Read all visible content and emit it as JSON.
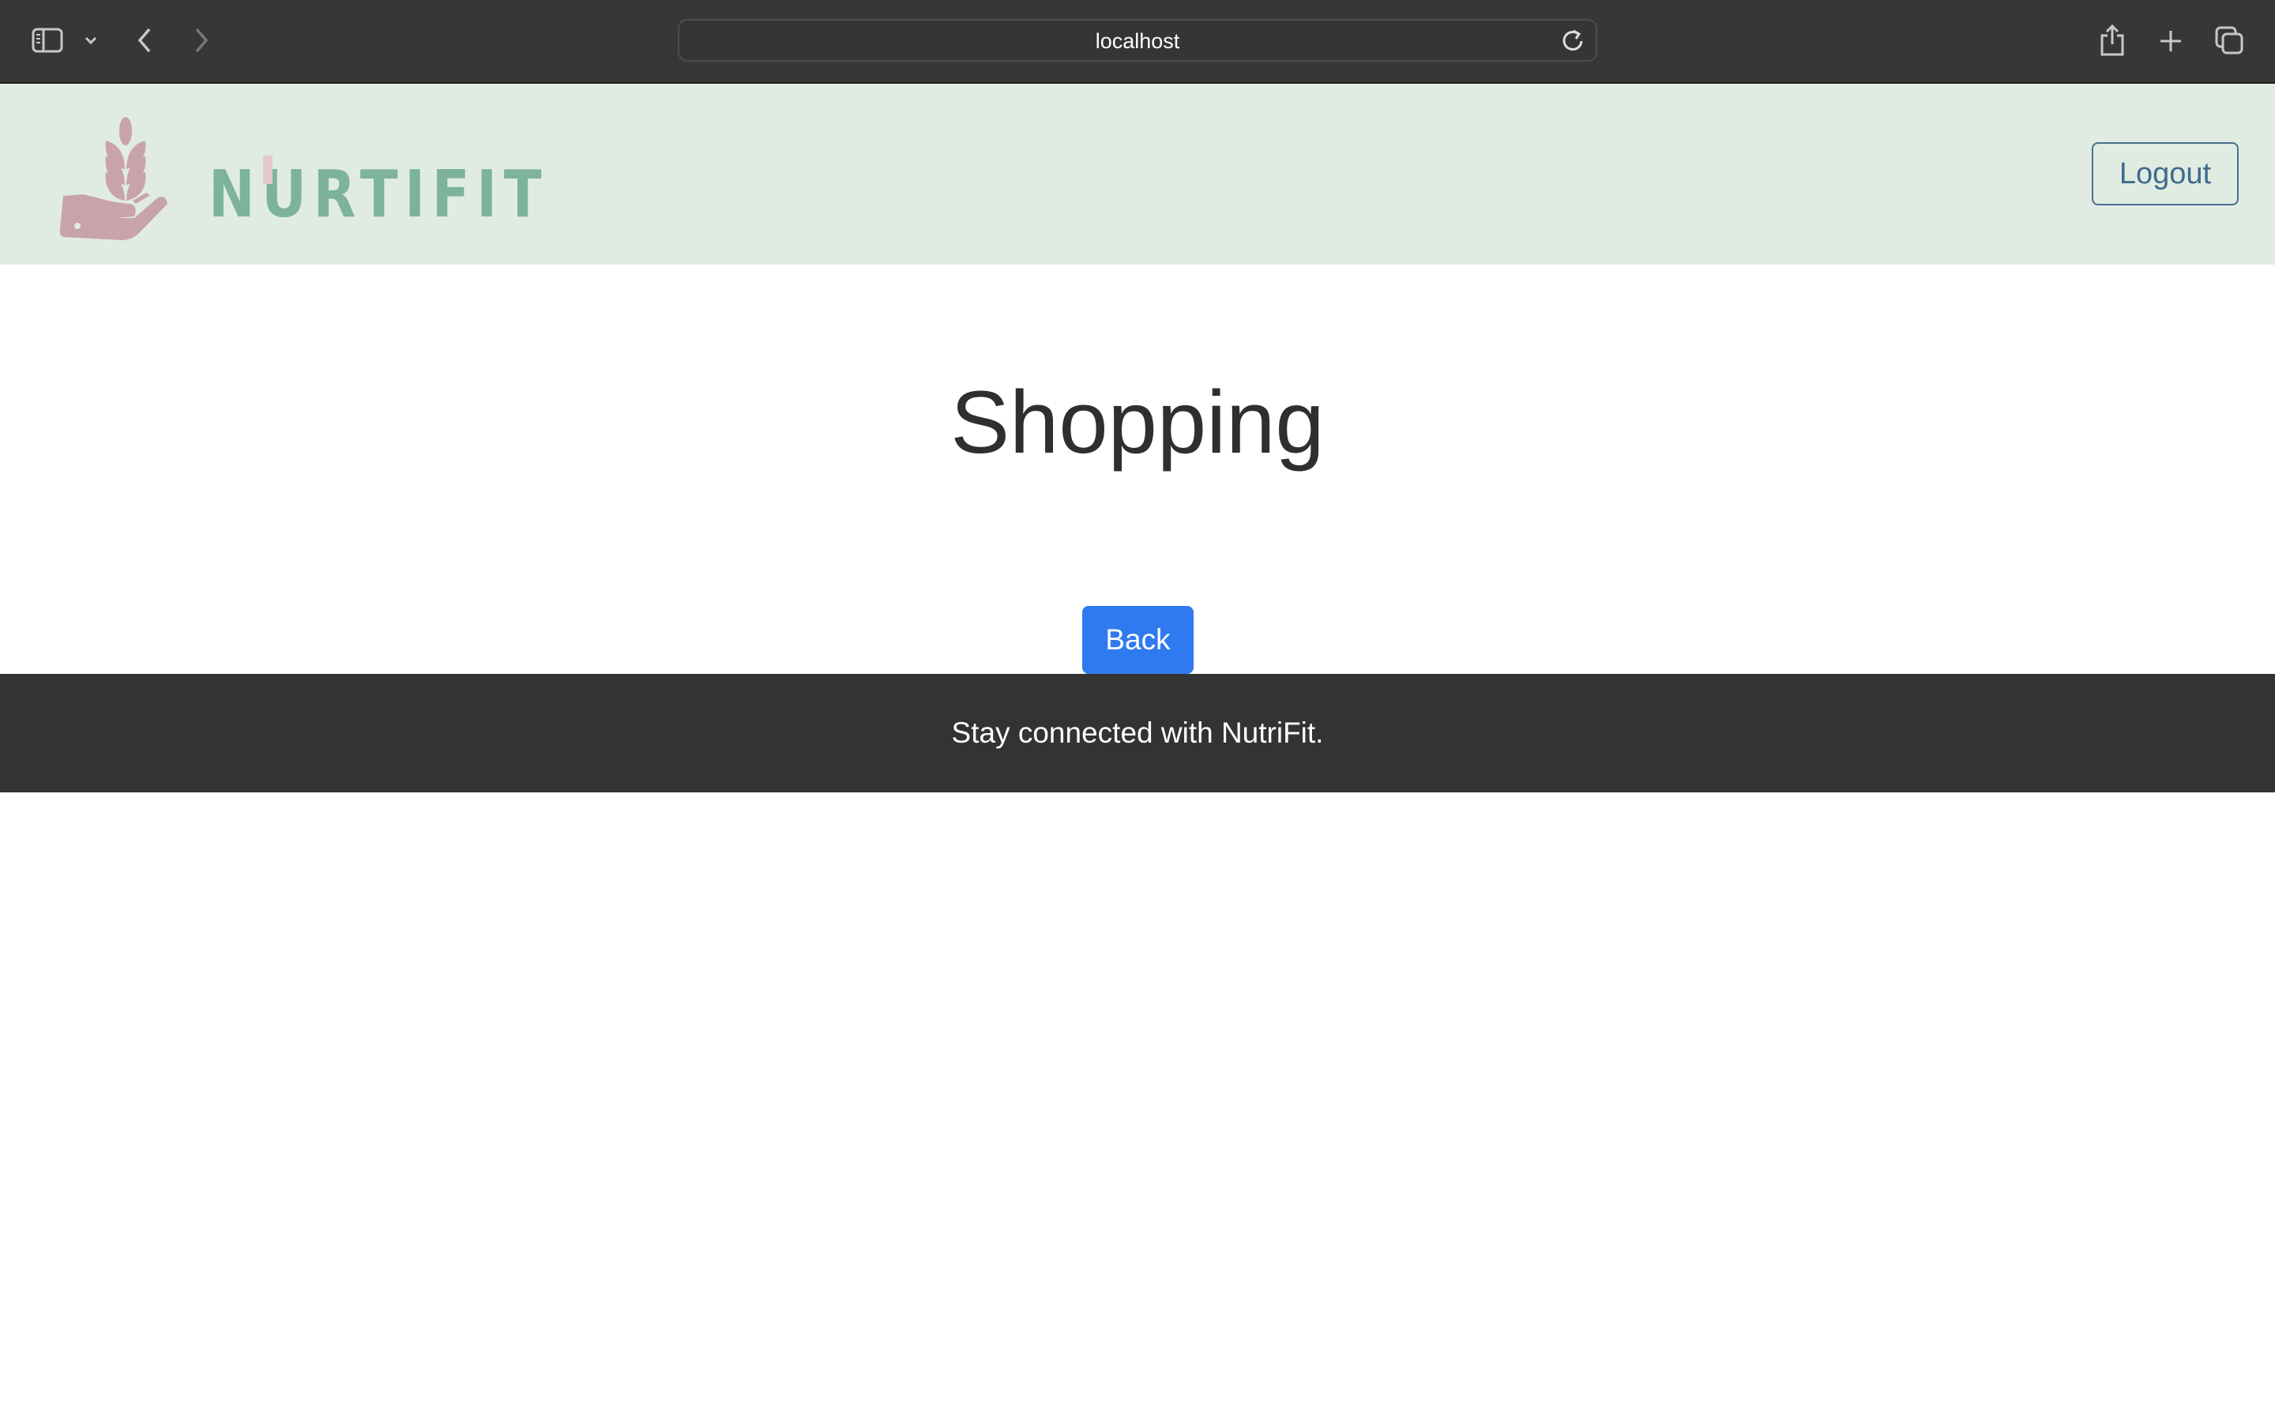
{
  "browser": {
    "url": "localhost",
    "icons": [
      "sidebar-icon",
      "chevron-down-icon",
      "back-icon",
      "forward-icon",
      "reload-icon",
      "share-icon",
      "new-tab-icon",
      "tabs-overview-icon"
    ]
  },
  "header": {
    "logo_text": "NURTIFIT",
    "logout_label": "Logout"
  },
  "main": {
    "title": "Shopping",
    "back_label": "Back"
  },
  "footer": {
    "text": "Stay connected with NutriFit."
  },
  "colors": {
    "header_bg": "#e0ebe1",
    "logo_green": "#7db39a",
    "logo_pink": "#c9a3aa",
    "primary": "#2f7af0",
    "footer_bg": "#333333"
  }
}
